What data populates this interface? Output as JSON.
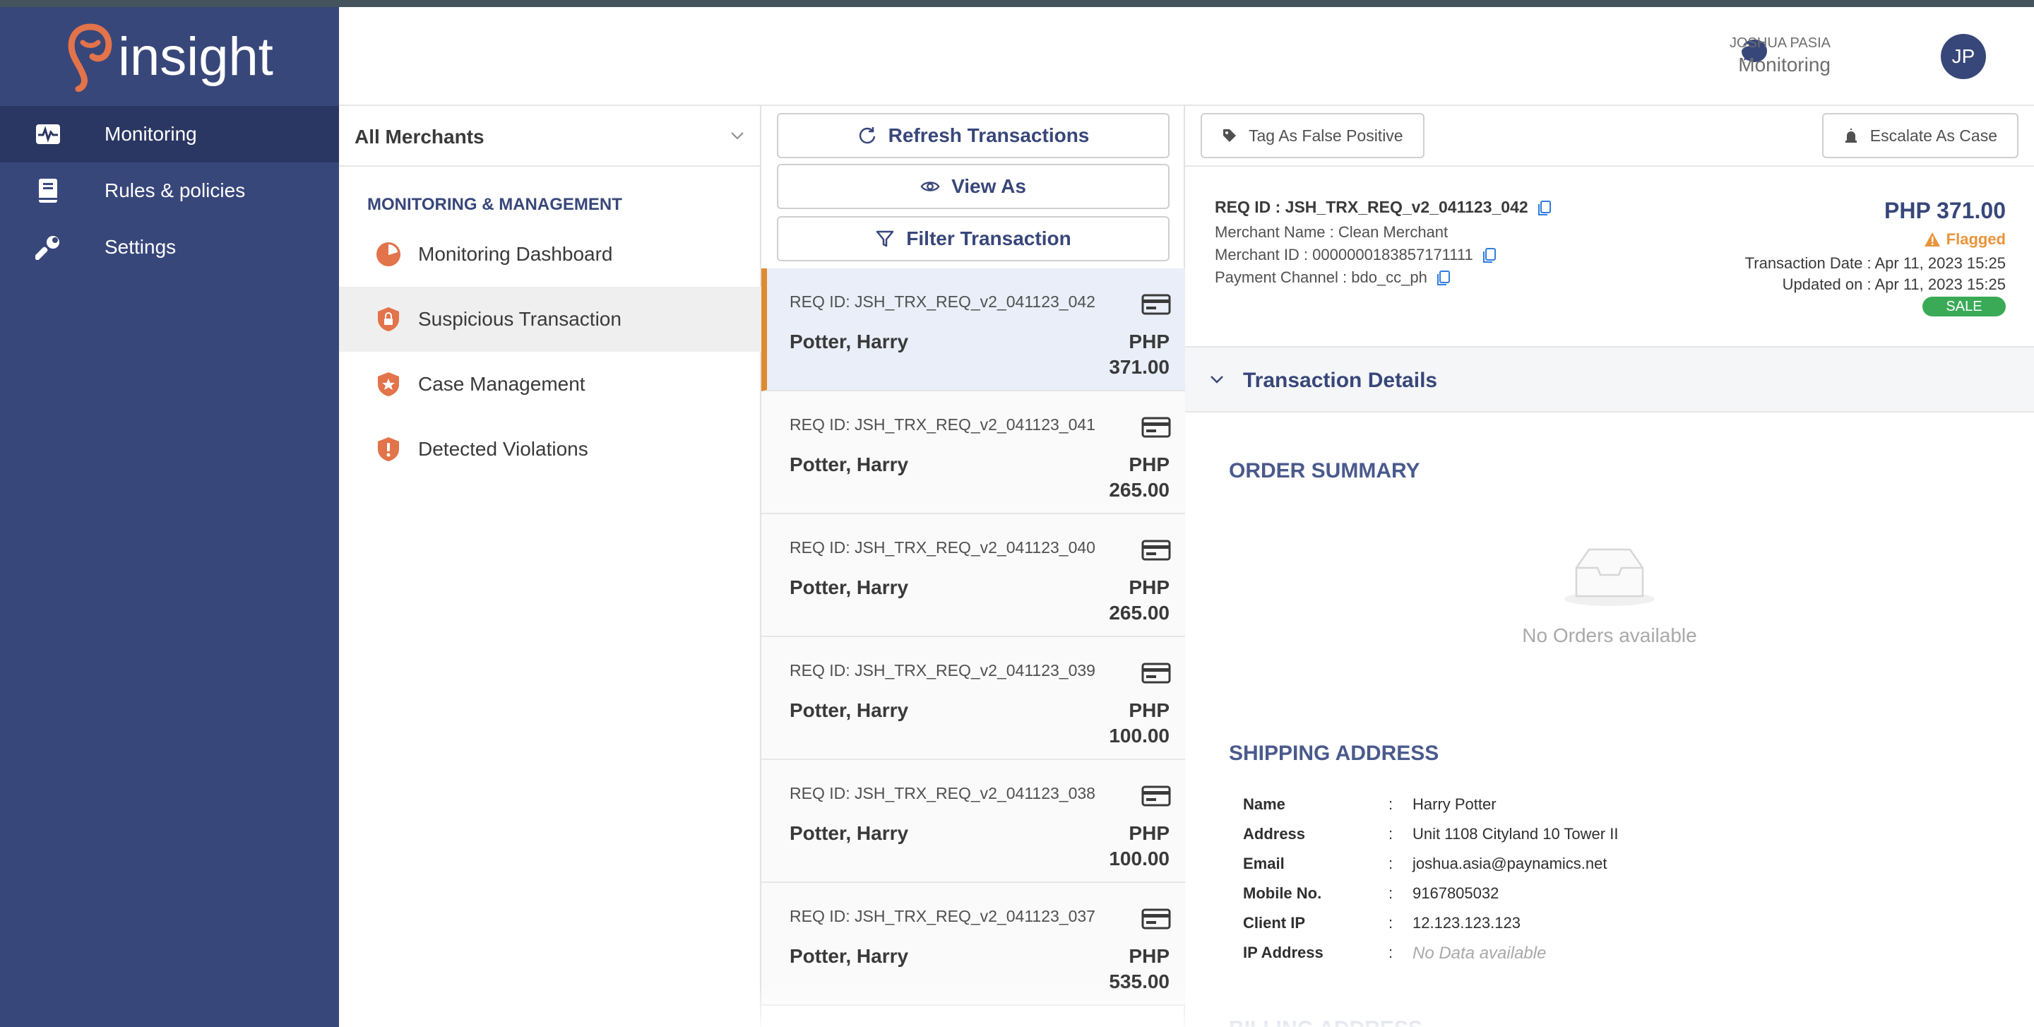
{
  "app": {
    "brand": "insight"
  },
  "sidebar": {
    "items": [
      {
        "label": "Monitoring",
        "icon": "pulse-icon",
        "active": true
      },
      {
        "label": "Rules & policies",
        "icon": "book-icon",
        "active": false
      },
      {
        "label": "Settings",
        "icon": "wrench-icon",
        "active": false
      }
    ]
  },
  "header": {
    "user_name": "JOSHUA PASIA",
    "user_role": "Monitoring",
    "avatar_initials": "JP",
    "chat_icon": "chat-icon"
  },
  "submenu": {
    "merchant_select": "All Merchants",
    "section_title": "MONITORING & MANAGEMENT",
    "items": [
      {
        "label": "Monitoring Dashboard",
        "icon": "pie-chart-icon",
        "active": false
      },
      {
        "label": "Suspicious Transaction",
        "icon": "shield-lock-icon",
        "active": true
      },
      {
        "label": "Case Management",
        "icon": "shield-star-icon",
        "active": false
      },
      {
        "label": "Detected Violations",
        "icon": "shield-alert-icon",
        "active": false
      }
    ]
  },
  "transactions": {
    "refresh_label": "Refresh Transactions",
    "view_as_label": "View As",
    "filter_label": "Filter Transaction",
    "list": [
      {
        "req": "REQ ID: JSH_TRX_REQ_v2_041123_042",
        "name": "Potter, Harry",
        "currency": "PHP",
        "amount": "371.00",
        "active": true
      },
      {
        "req": "REQ ID: JSH_TRX_REQ_v2_041123_041",
        "name": "Potter, Harry",
        "currency": "PHP",
        "amount": "265.00",
        "active": false
      },
      {
        "req": "REQ ID: JSH_TRX_REQ_v2_041123_040",
        "name": "Potter, Harry",
        "currency": "PHP",
        "amount": "265.00",
        "active": false
      },
      {
        "req": "REQ ID: JSH_TRX_REQ_v2_041123_039",
        "name": "Potter, Harry",
        "currency": "PHP",
        "amount": "100.00",
        "active": false
      },
      {
        "req": "REQ ID: JSH_TRX_REQ_v2_041123_038",
        "name": "Potter, Harry",
        "currency": "PHP",
        "amount": "100.00",
        "active": false
      },
      {
        "req": "REQ ID: JSH_TRX_REQ_v2_041123_037",
        "name": "Potter, Harry",
        "currency": "PHP",
        "amount": "535.00",
        "active": false
      }
    ]
  },
  "detail": {
    "tag_false_positive_label": "Tag As False Positive",
    "escalate_label": "Escalate As Case",
    "req_id": "REQ ID : JSH_TRX_REQ_v2_041123_042",
    "merchant_name": "Merchant Name : Clean Merchant",
    "merchant_id": "Merchant ID :  0000000183857171111",
    "payment_channel": "Payment Channel :  bdo_cc_ph",
    "amount": "PHP 371.00",
    "status": "Flagged",
    "transaction_date": "Transaction Date : Apr 11, 2023 15:25",
    "updated_on": "Updated on : Apr 11, 2023 15:25",
    "type_badge": "SALE",
    "details_section_label": "Transaction Details",
    "order_summary_title": "ORDER SUMMARY",
    "no_orders_text": "No Orders available",
    "shipping_title": "SHIPPING ADDRESS",
    "shipping": [
      {
        "key": "Name",
        "value": "Harry Potter",
        "empty": false
      },
      {
        "key": "Address",
        "value": "Unit 1108 Cityland 10 Tower II",
        "empty": false
      },
      {
        "key": "Email",
        "value": "joshua.asia@paynamics.net",
        "empty": false
      },
      {
        "key": "Mobile No.",
        "value": "9167805032",
        "empty": false
      },
      {
        "key": "Client IP",
        "value": "12.123.123.123",
        "empty": false
      },
      {
        "key": "IP Address",
        "value": "No Data available",
        "empty": true
      }
    ],
    "billing_title": "BILLING ADDRESS"
  },
  "colors": {
    "sidebar": "#38477a",
    "accent": "#e08a2e",
    "brand_orange": "#e2734a",
    "flag": "#e8943a",
    "sale": "#3aaa57"
  }
}
